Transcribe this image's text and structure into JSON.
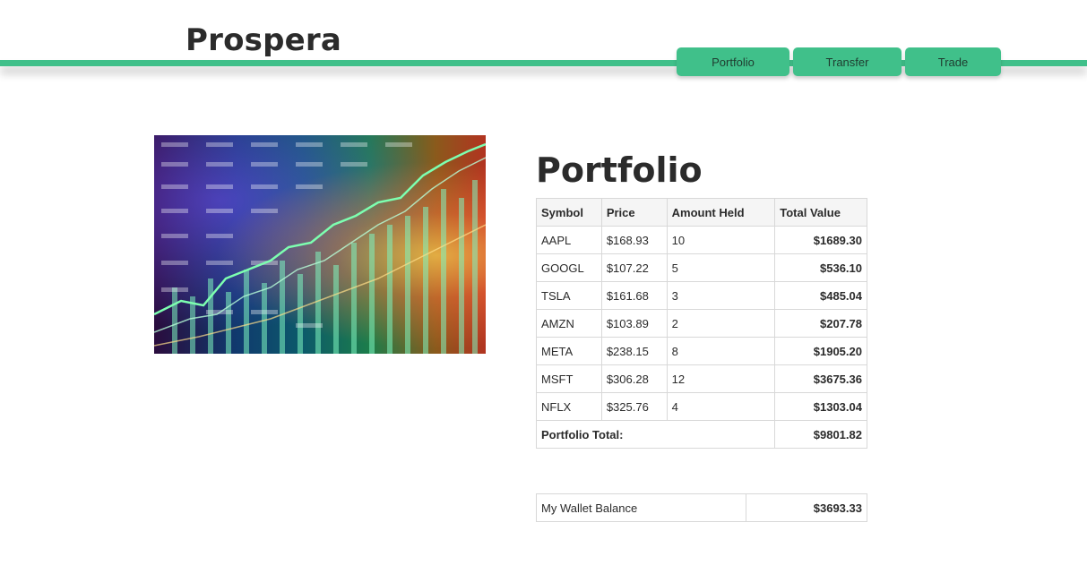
{
  "brand": {
    "name": "Prospera"
  },
  "nav": {
    "items": [
      {
        "label": "Portfolio"
      },
      {
        "label": "Transfer"
      },
      {
        "label": "Trade"
      }
    ]
  },
  "colors": {
    "accent": "#40c08a"
  },
  "image": {
    "subject": "stock-market-chart-image"
  },
  "portfolio": {
    "title": "Portfolio",
    "columns": [
      "Symbol",
      "Price",
      "Amount Held",
      "Total Value"
    ],
    "rows": [
      {
        "symbol": "AAPL",
        "price": "$168.93",
        "amount": "10",
        "total": "$1689.30"
      },
      {
        "symbol": "GOOGL",
        "price": "$107.22",
        "amount": "5",
        "total": "$536.10"
      },
      {
        "symbol": "TSLA",
        "price": "$161.68",
        "amount": "3",
        "total": "$485.04"
      },
      {
        "symbol": "AMZN",
        "price": "$103.89",
        "amount": "2",
        "total": "$207.78"
      },
      {
        "symbol": "META",
        "price": "$238.15",
        "amount": "8",
        "total": "$1905.20"
      },
      {
        "symbol": "MSFT",
        "price": "$306.28",
        "amount": "12",
        "total": "$3675.36"
      },
      {
        "symbol": "NFLX",
        "price": "$325.76",
        "amount": "4",
        "total": "$1303.04"
      }
    ],
    "total_label": "Portfolio Total:",
    "total_value": "$9801.82"
  },
  "wallet": {
    "label": "My Wallet Balance",
    "value": "$3693.33"
  }
}
